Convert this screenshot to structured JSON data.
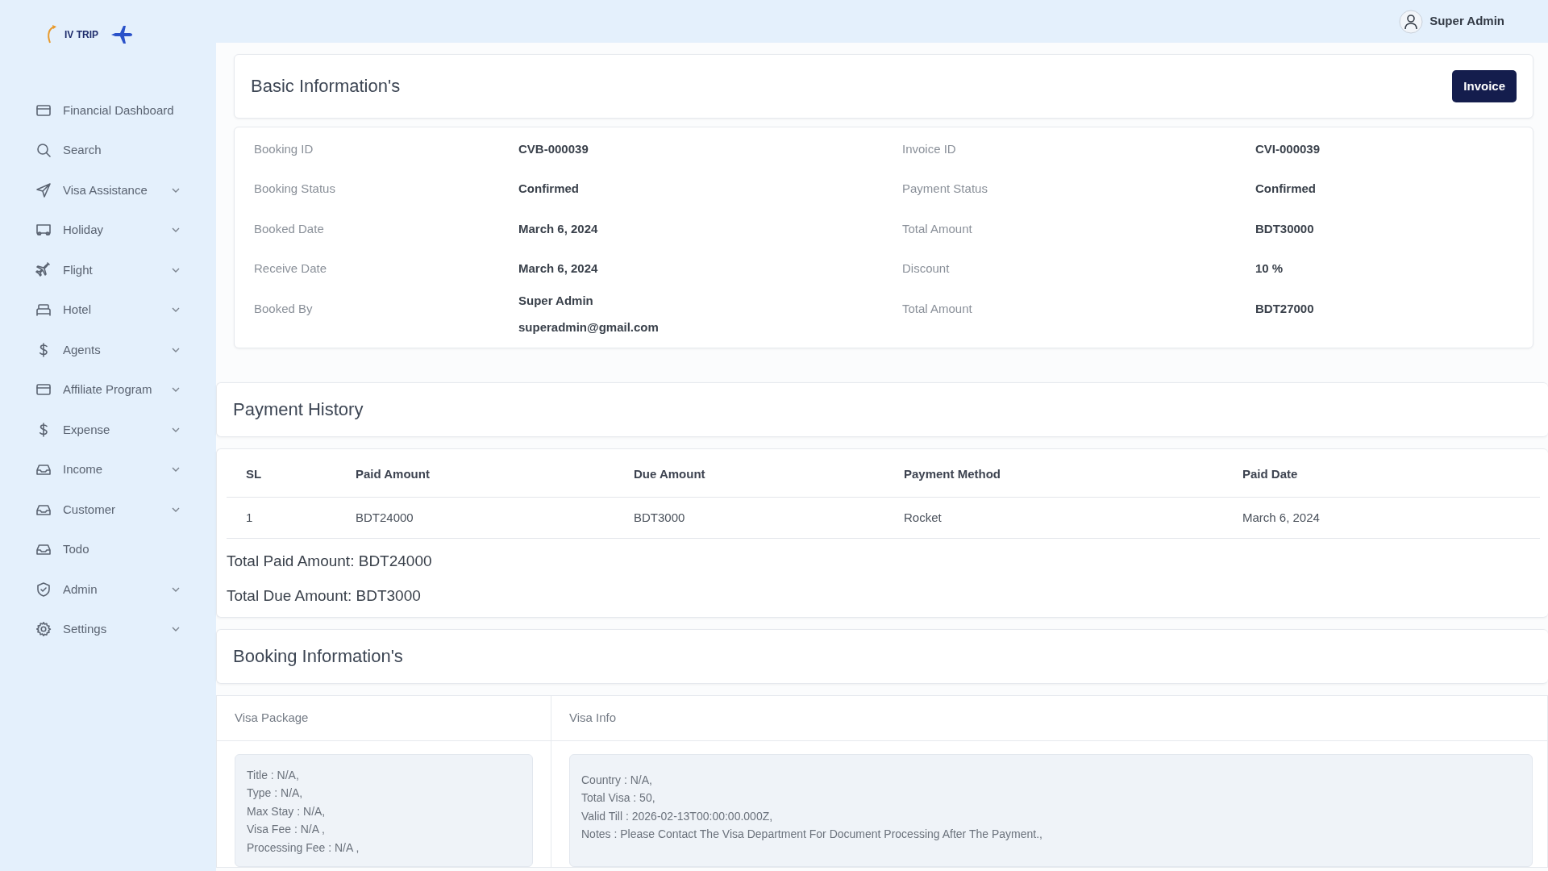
{
  "brand": {
    "name": "IV TRIP"
  },
  "user": {
    "name": "Super Admin"
  },
  "sidebar": {
    "items": [
      {
        "label": "Financial Dashboard",
        "expandable": false
      },
      {
        "label": "Search",
        "expandable": false
      },
      {
        "label": "Visa Assistance",
        "expandable": true
      },
      {
        "label": "Holiday",
        "expandable": true
      },
      {
        "label": "Flight",
        "expandable": true
      },
      {
        "label": "Hotel",
        "expandable": true
      },
      {
        "label": "Agents",
        "expandable": true
      },
      {
        "label": "Affiliate Program",
        "expandable": true
      },
      {
        "label": "Expense",
        "expandable": true
      },
      {
        "label": "Income",
        "expandable": true
      },
      {
        "label": "Customer",
        "expandable": true
      },
      {
        "label": "Todo",
        "expandable": false
      },
      {
        "label": "Admin",
        "expandable": true
      },
      {
        "label": "Settings",
        "expandable": true
      }
    ]
  },
  "basic_info": {
    "title": "Basic Information's",
    "invoice_button": "Invoice",
    "rows": [
      {
        "left_label": "Booking ID",
        "left_values": [
          "CVB-000039"
        ],
        "right_label": "Invoice ID",
        "right_value": "CVI-000039"
      },
      {
        "left_label": "Booking Status",
        "left_values": [
          "Confirmed"
        ],
        "right_label": "Payment Status",
        "right_value": "Confirmed"
      },
      {
        "left_label": "Booked Date",
        "left_values": [
          "March 6, 2024"
        ],
        "right_label": "Total Amount",
        "right_value": "BDT30000"
      },
      {
        "left_label": "Receive Date",
        "left_values": [
          "March 6, 2024"
        ],
        "right_label": "Discount",
        "right_value": "10 %"
      },
      {
        "left_label": "Booked By",
        "left_values": [
          "Super Admin",
          "superadmin@gmail.com"
        ],
        "right_label": "Total Amount",
        "right_value": "BDT27000"
      }
    ]
  },
  "payment_history": {
    "title": "Payment History",
    "columns": [
      "SL",
      "Paid Amount",
      "Due Amount",
      "Payment Method",
      "Paid Date"
    ],
    "rows": [
      [
        "1",
        "BDT24000",
        "BDT3000",
        "Rocket",
        "March 6, 2024"
      ]
    ],
    "totals": [
      "Total Paid Amount: BDT24000",
      "Total Due Amount: BDT3000"
    ]
  },
  "booking_info": {
    "title": "Booking Information's",
    "sections": [
      {
        "heading": "Visa Package",
        "lines": [
          "Title : N/A,",
          "Type : N/A,",
          "Max Stay : N/A,",
          "Visa Fee : N/A ,",
          "Processing Fee : N/A ,"
        ]
      },
      {
        "heading": "Visa Info",
        "lines": [
          "Country : N/A,",
          "Total Visa : 50,",
          "Valid Till : 2026-02-13T00:00:00.000Z,",
          "Notes : Please Contact The Visa Department For Document Processing After The Payment.,"
        ]
      }
    ]
  }
}
